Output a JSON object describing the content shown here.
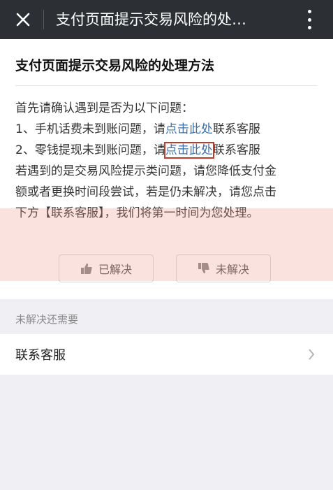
{
  "topbar": {
    "title": "支付页面提示交易风险的处…",
    "close_icon": "close-icon",
    "more_icon": "more-vertical-icon"
  },
  "article": {
    "title": "支付页面提示交易风险的处理方法",
    "line1": "首先请确认遇到是否为以下问题：",
    "item1_prefix": "1、手机话费未到账问题，请",
    "item1_link": "点击此处",
    "item1_suffix": "联系客服",
    "item2_prefix": "2、零钱提现未到账问题，请",
    "item2_link": "点击此处",
    "item2_suffix": "联系客服",
    "para_line1": "若遇到的是交易风险提示类问题，请您降低支付金",
    "para_line2": "额或者更换时间段尝试，若是仍未解决，请您点击",
    "para_line3": "下方【联系客服】，我们将第一时间为您处理。"
  },
  "feedback": {
    "solved_label": "已解决",
    "unsolved_label": "未解决"
  },
  "section": {
    "label": "未解决还需要",
    "service_label": "联系客服"
  },
  "colors": {
    "topbar_bg": "#2c2f33",
    "link": "#3d6fa8",
    "highlight_box": "#c0392b",
    "page_bg": "#efeff4"
  }
}
